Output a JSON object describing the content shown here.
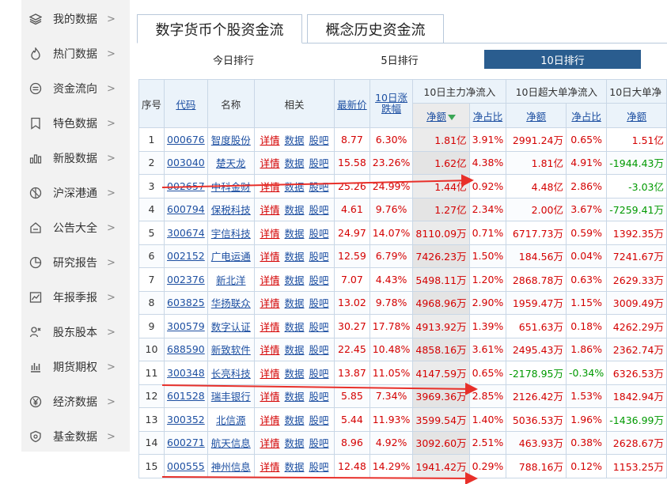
{
  "sidebar": {
    "items": [
      {
        "label": "我的数据",
        "icon": "layers-icon"
      },
      {
        "label": "热门数据",
        "icon": "flame-icon"
      },
      {
        "label": "资金流向",
        "icon": "money-flow-icon"
      },
      {
        "label": "特色数据",
        "icon": "bookmark-icon"
      },
      {
        "label": "新股数据",
        "icon": "new-stock-icon"
      },
      {
        "label": "沪深港通",
        "icon": "globe-icon"
      },
      {
        "label": "公告大全",
        "icon": "announcement-icon"
      },
      {
        "label": "研究报告",
        "icon": "pie-chart-icon"
      },
      {
        "label": "年报季报",
        "icon": "report-chart-icon"
      },
      {
        "label": "股东股本",
        "icon": "shareholder-icon"
      },
      {
        "label": "期货期权",
        "icon": "bar-chart-icon"
      },
      {
        "label": "经济数据",
        "icon": "yen-icon"
      },
      {
        "label": "基金数据",
        "icon": "shield-icon"
      }
    ],
    "arrow": ">"
  },
  "tabs": [
    "数字货币个股资金流",
    "概念历史资金流"
  ],
  "subtabs": [
    "今日排行",
    "5日排行",
    "10日排行"
  ],
  "table": {
    "headers": {
      "seq": "序号",
      "code": "代码",
      "name": "名称",
      "related": "相关",
      "price": "最新价",
      "change": "10日涨跌幅",
      "main": "10日主力净流入",
      "super": "10日超大单净流入",
      "large": "10日大单净",
      "net_amount": "净额",
      "net_ratio": "净占比"
    },
    "related_links": [
      "详情",
      "数据",
      "股吧"
    ],
    "rows": [
      [
        "1",
        "000676",
        "智度股份",
        "8.77",
        "6.30%",
        "1.81亿",
        "3.91%",
        "2991.24万",
        "0.65%",
        "1.51亿"
      ],
      [
        "2",
        "003040",
        "楚天龙",
        "15.58",
        "23.26%",
        "1.62亿",
        "4.38%",
        "1.81亿",
        "4.91%",
        "-1944.43万"
      ],
      [
        "3",
        "002657",
        "中科金财",
        "25.26",
        "24.99%",
        "1.44亿",
        "0.92%",
        "4.48亿",
        "2.86%",
        "-3.03亿"
      ],
      [
        "4",
        "600794",
        "保税科技",
        "4.61",
        "9.76%",
        "1.27亿",
        "2.34%",
        "2.00亿",
        "3.67%",
        "-7259.41万"
      ],
      [
        "5",
        "300674",
        "宇信科技",
        "24.97",
        "14.07%",
        "8110.09万",
        "0.71%",
        "6717.73万",
        "0.59%",
        "1392.35万"
      ],
      [
        "6",
        "002152",
        "广电运通",
        "12.59",
        "6.79%",
        "7426.23万",
        "1.50%",
        "184.56万",
        "0.04%",
        "7241.67万"
      ],
      [
        "7",
        "002376",
        "新北洋",
        "7.07",
        "4.43%",
        "5498.11万",
        "1.20%",
        "2868.78万",
        "0.63%",
        "2629.33万"
      ],
      [
        "8",
        "603825",
        "华扬联众",
        "13.02",
        "9.78%",
        "4968.96万",
        "2.90%",
        "1959.47万",
        "1.15%",
        "3009.49万"
      ],
      [
        "9",
        "300579",
        "数字认证",
        "30.27",
        "17.78%",
        "4913.92万",
        "1.39%",
        "651.63万",
        "0.18%",
        "4262.29万"
      ],
      [
        "10",
        "688590",
        "新致软件",
        "22.45",
        "10.48%",
        "4858.16万",
        "3.61%",
        "2495.43万",
        "1.86%",
        "2362.74万"
      ],
      [
        "11",
        "300348",
        "长亮科技",
        "13.87",
        "11.05%",
        "4147.59万",
        "0.65%",
        "-2178.95万",
        "-0.34%",
        "6326.53万"
      ],
      [
        "12",
        "601528",
        "瑞丰银行",
        "5.85",
        "7.34%",
        "3969.36万",
        "2.85%",
        "2126.42万",
        "1.53%",
        "1842.94万"
      ],
      [
        "13",
        "300352",
        "北信源",
        "5.44",
        "11.93%",
        "3599.54万",
        "1.40%",
        "5036.53万",
        "1.96%",
        "-1436.99万"
      ],
      [
        "14",
        "600271",
        "航天信息",
        "8.96",
        "4.92%",
        "3092.60万",
        "2.51%",
        "463.93万",
        "0.38%",
        "2628.67万"
      ],
      [
        "15",
        "000555",
        "神州信息",
        "12.48",
        "14.29%",
        "1941.42万",
        "0.29%",
        "788.16万",
        "0.12%",
        "1153.25万"
      ]
    ]
  },
  "colors": {
    "accent": "#2a5d8f",
    "up": "#d40000",
    "down": "#009900",
    "link": "#1e50a2",
    "annotation": "#e8302a"
  }
}
